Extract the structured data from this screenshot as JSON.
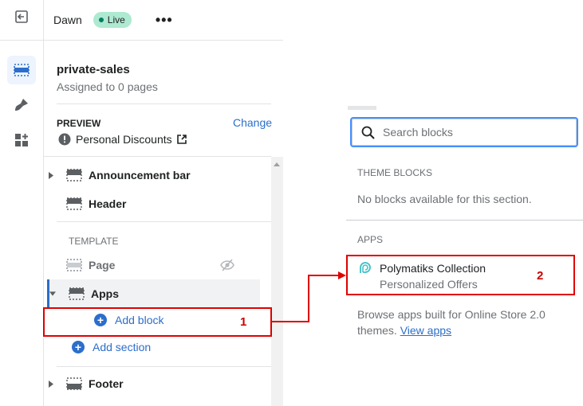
{
  "topbar": {
    "theme_name": "Dawn",
    "live_badge": "Live",
    "more_label": "•••"
  },
  "rail": {
    "icons": [
      "exit-icon",
      "sections-icon",
      "brush-icon",
      "apps-grid-icon"
    ]
  },
  "panel": {
    "template_name": "private-sales",
    "assigned": "Assigned to 0 pages",
    "preview_label": "PREVIEW",
    "change_label": "Change",
    "preview_value": "Personal Discounts",
    "sections_before": [
      {
        "label": "Announcement bar"
      },
      {
        "label": "Header"
      }
    ],
    "template_label": "TEMPLATE",
    "page_label": "Page",
    "apps_label": "Apps",
    "add_block_label": "Add block",
    "add_section_label": "Add section",
    "footer_label": "Footer"
  },
  "popover": {
    "search_placeholder": "Search blocks",
    "theme_blocks_heading": "THEME BLOCKS",
    "no_blocks_text": "No blocks available for this section.",
    "apps_heading": "APPS",
    "app_name": "Polymatiks Collection",
    "app_subtitle": "Personalized Offers",
    "browse_text": "Browse apps built for Online Store 2.0 themes.",
    "view_apps_link": "View apps"
  },
  "annotations": {
    "step1": "1",
    "step2": "2"
  },
  "colors": {
    "accent": "#2c6ecb",
    "live": "#aee9d1",
    "annotation": "#e00000"
  }
}
